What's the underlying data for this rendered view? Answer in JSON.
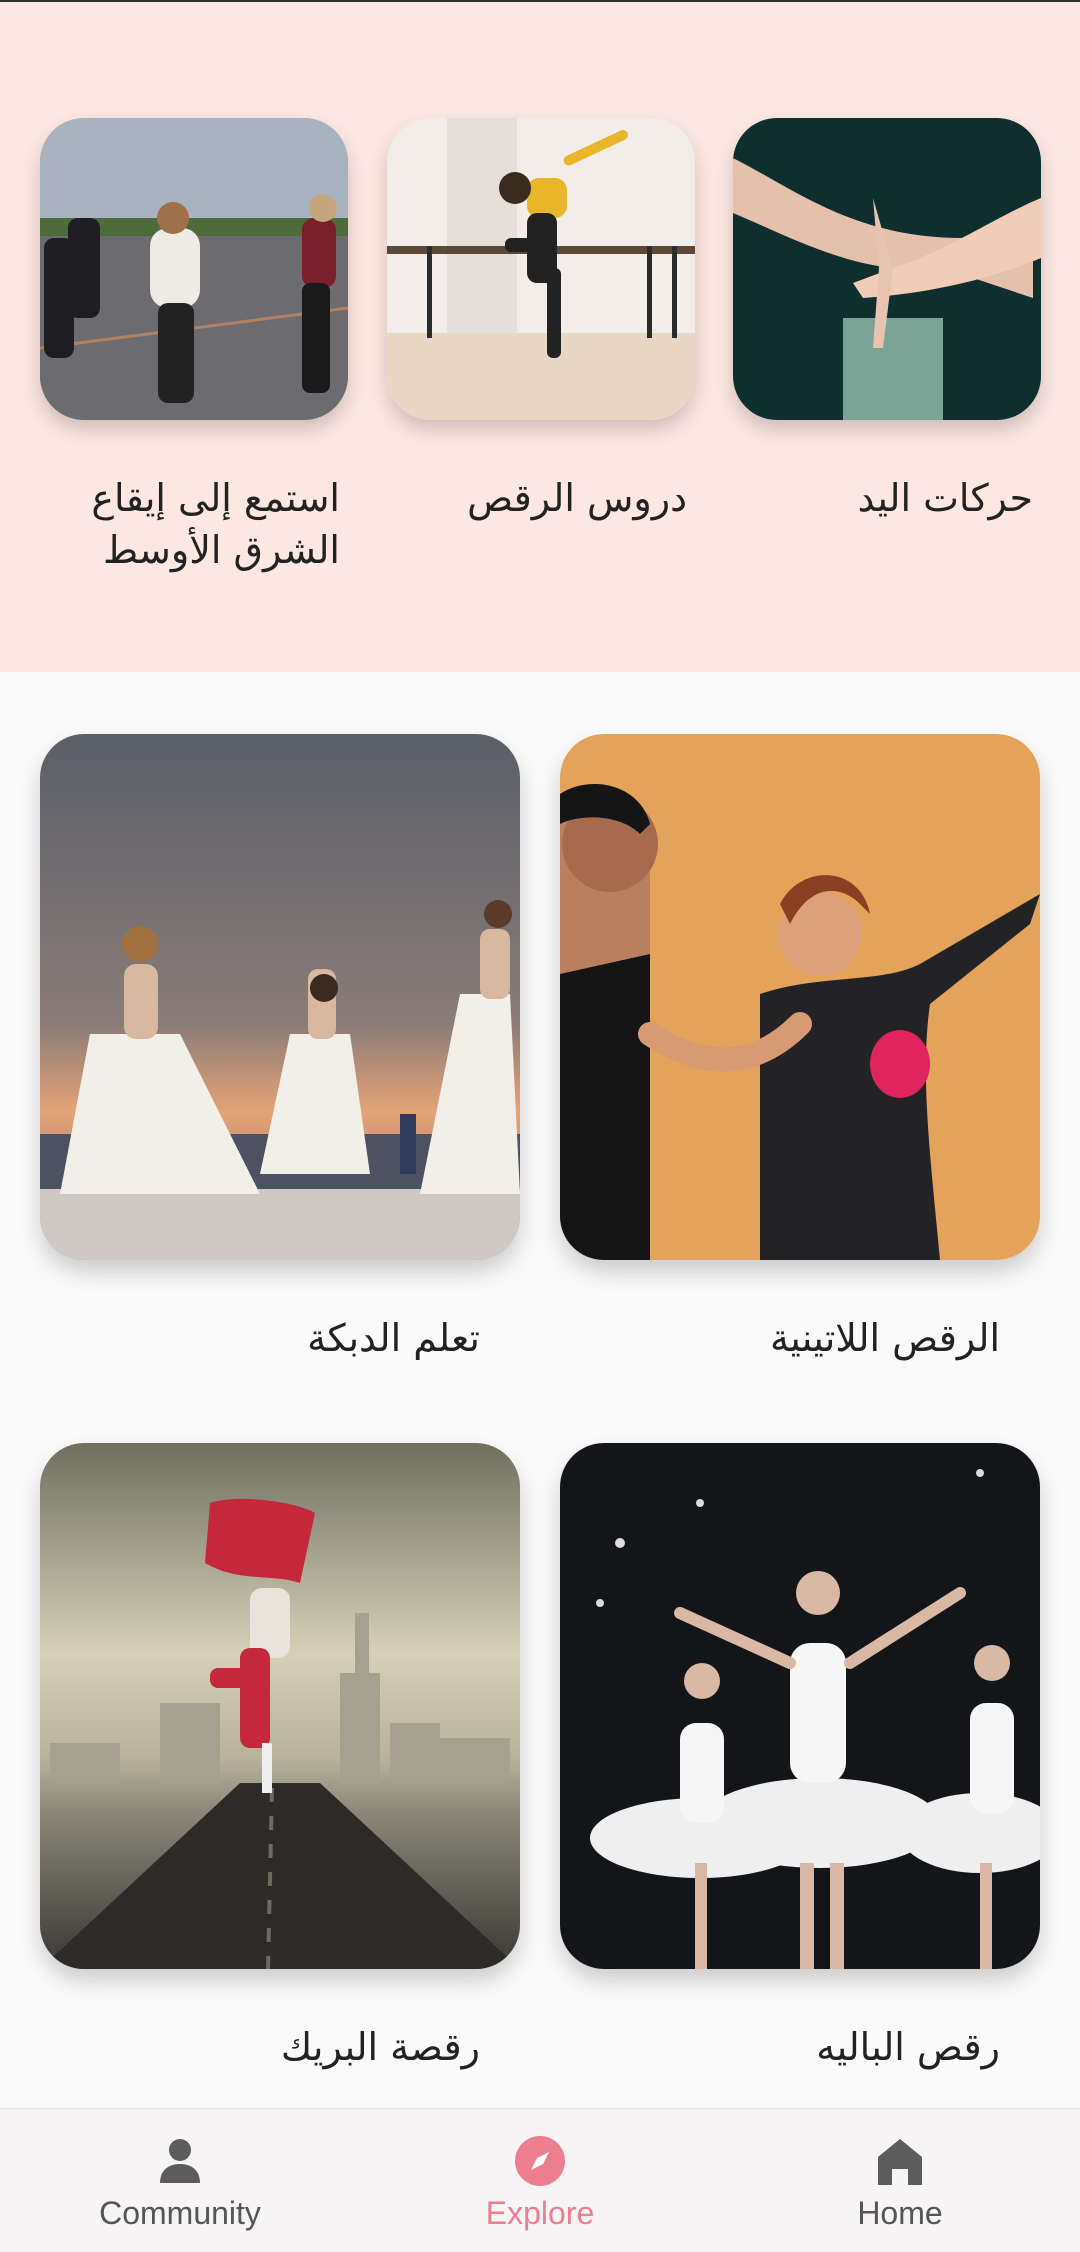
{
  "top_cards": [
    {
      "label": "حركات اليد",
      "image": "hands-gesture-photo"
    },
    {
      "label": "دروس الرقص",
      "image": "dance-class-photo"
    },
    {
      "label": "استمع إلى إيقاع الشرق الأوسط",
      "image": "group-dancing-photo"
    }
  ],
  "grid_cards": [
    {
      "label": "الرقص اللاتينية",
      "image": "latin-dance-photo"
    },
    {
      "label": "تعلم الدبكة",
      "image": "dabke-dancers-photo"
    },
    {
      "label": "رقص الباليه",
      "image": "ballet-photo"
    },
    {
      "label": "رقصة البريك",
      "image": "break-dance-photo"
    }
  ],
  "bottom_nav": {
    "items": [
      {
        "label": "Community",
        "icon": "person-icon"
      },
      {
        "label": "Explore",
        "icon": "compass-icon",
        "active": true
      },
      {
        "label": "Home",
        "icon": "home-icon"
      }
    ]
  },
  "colors": {
    "top_bg": "#fde7e2",
    "accent": "#ec7e8f",
    "nav_bg": "#f6f4f4"
  }
}
